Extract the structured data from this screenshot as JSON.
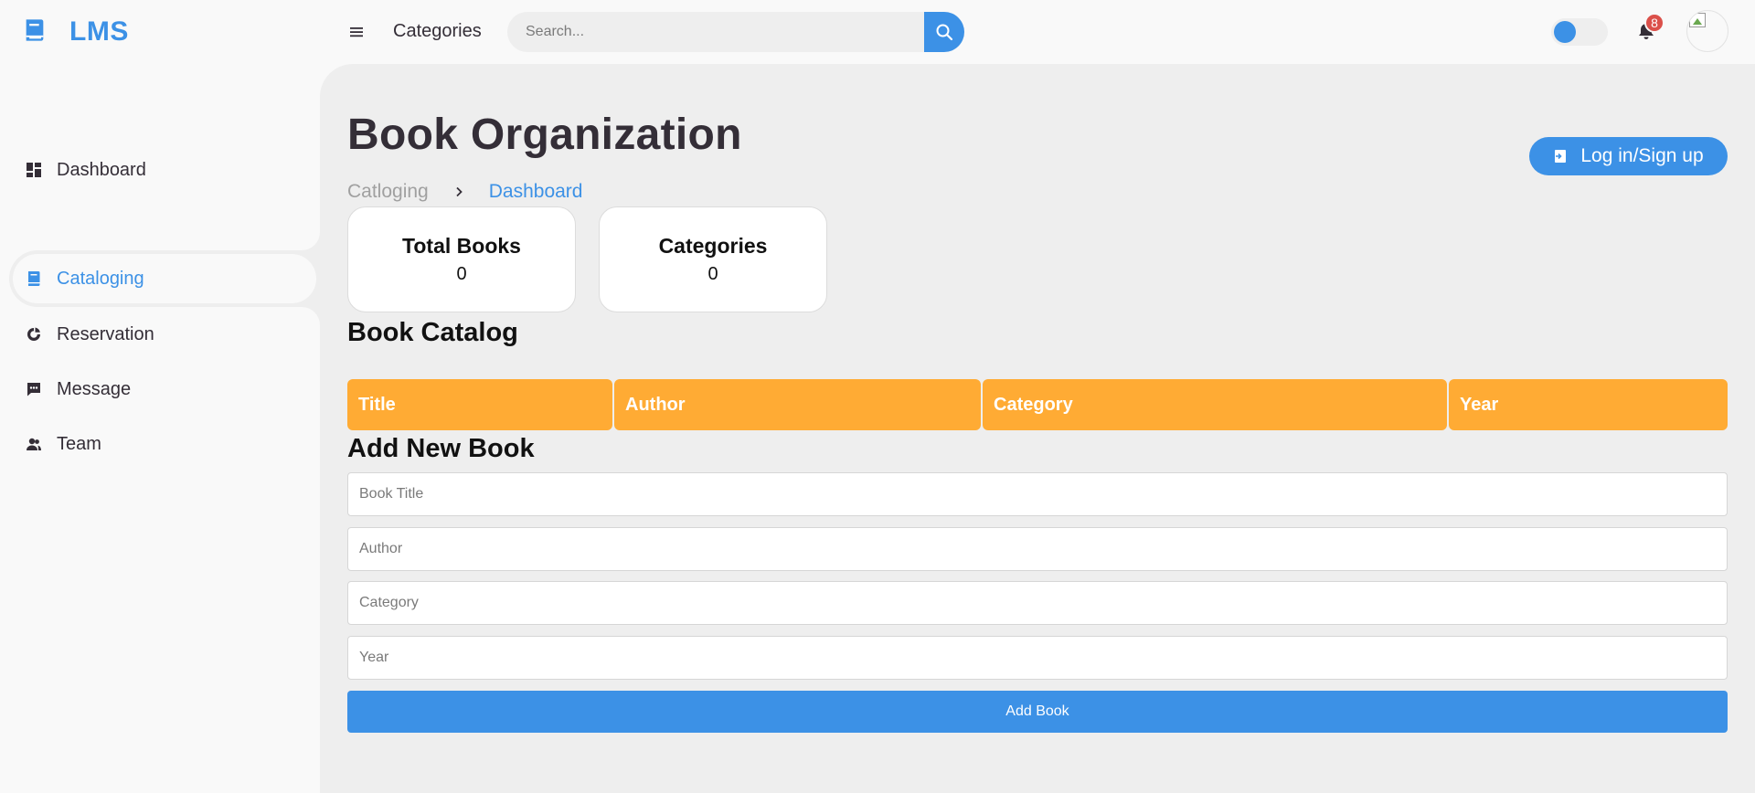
{
  "brand": {
    "name": "LMS",
    "icon": "book-icon",
    "color": "#3c91e6"
  },
  "sidebar": {
    "items": [
      {
        "label": "Dashboard",
        "icon": "dashboard-icon"
      },
      {
        "label": "Cataloging",
        "icon": "book-icon",
        "active": true
      },
      {
        "label": "Reservation",
        "icon": "pie-chart-icon"
      },
      {
        "label": "Message",
        "icon": "message-icon"
      },
      {
        "label": "Team",
        "icon": "team-icon"
      }
    ]
  },
  "topnav": {
    "link": "Categories",
    "search": {
      "placeholder": "Search..."
    },
    "notifications": {
      "count": "8"
    }
  },
  "main": {
    "title": "Book Organization",
    "breadcrumb": [
      "Catloging",
      "Dashboard"
    ],
    "login_button": "Log in/Sign up",
    "stats": [
      {
        "label": "Total Books",
        "value": "0"
      },
      {
        "label": "Categories",
        "value": "0"
      }
    ],
    "catalog": {
      "title": "Book Catalog",
      "columns": [
        "Title",
        "Author",
        "Category",
        "Year"
      ]
    },
    "add_form": {
      "title": "Add New Book",
      "fields": [
        {
          "placeholder": "Book Title"
        },
        {
          "placeholder": "Author"
        },
        {
          "placeholder": "Category"
        },
        {
          "placeholder": "Year"
        }
      ],
      "submit": "Add Book"
    }
  },
  "colors": {
    "accent": "#3c91e6",
    "table_header": "#ffab34",
    "badge": "#db504a"
  }
}
